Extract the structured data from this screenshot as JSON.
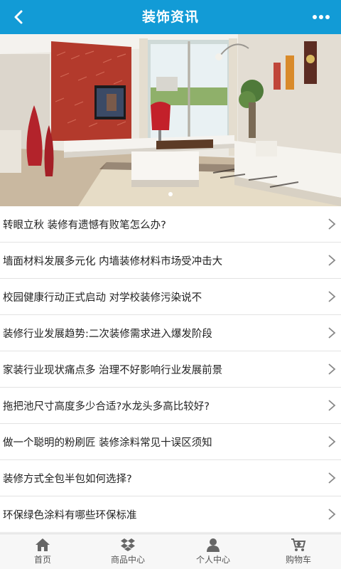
{
  "header": {
    "title": "装饰资讯",
    "back_icon": "back-arrow-icon",
    "more_icon": "more-dots-icon",
    "color": "#129bd6"
  },
  "banner": {
    "image": "living-room-photo",
    "slides": 1,
    "active_slide": 1
  },
  "articles": [
    {
      "title": "转眼立秋 装修有遗憾有败笔怎么办?"
    },
    {
      "title": "墙面材料发展多元化 内墙装修材料市场受冲击大"
    },
    {
      "title": "校园健康行动正式启动 对学校装修污染说不"
    },
    {
      "title": "装修行业发展趋势:二次装修需求进入爆发阶段"
    },
    {
      "title": "家装行业现状痛点多 治理不好影响行业发展前景"
    },
    {
      "title": "拖把池尺寸高度多少合适?水龙头多高比较好?"
    },
    {
      "title": "做一个聪明的粉刷匠 装修涂料常见十误区须知"
    },
    {
      "title": "装修方式全包半包如何选择?"
    },
    {
      "title": "环保绿色涂料有哪些环保标准"
    }
  ],
  "tabbar": {
    "items": [
      {
        "label": "首页",
        "icon": "home-icon"
      },
      {
        "label": "商品中心",
        "icon": "dropbox-icon"
      },
      {
        "label": "个人中心",
        "icon": "user-icon"
      },
      {
        "label": "购物车",
        "icon": "cart-icon"
      }
    ]
  }
}
